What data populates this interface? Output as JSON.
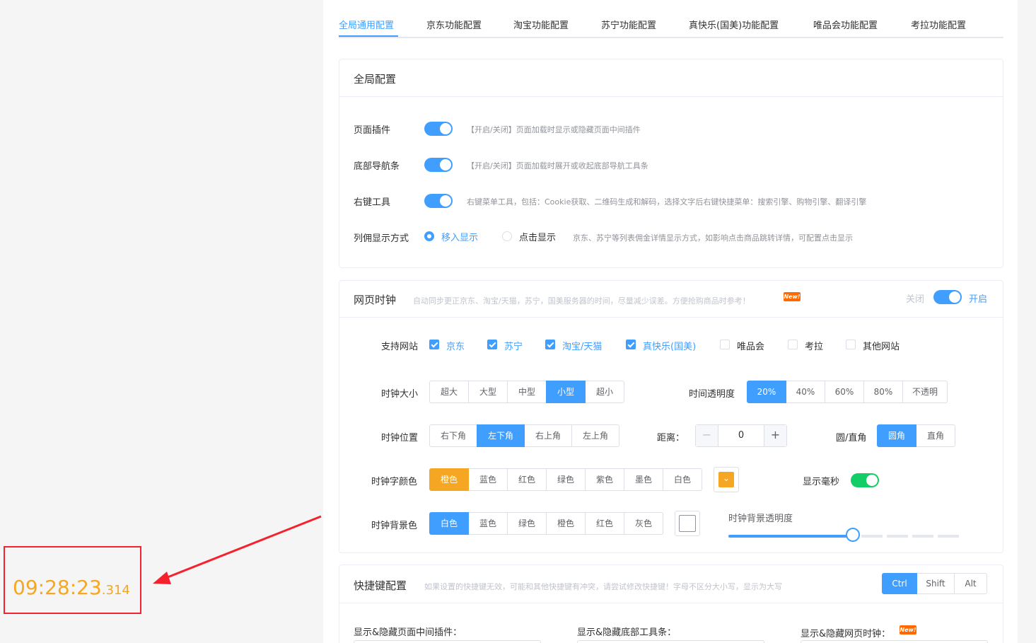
{
  "tabs": [
    "全局通用配置",
    "京东功能配置",
    "淘宝功能配置",
    "苏宁功能配置",
    "真快乐(国美)功能配置",
    "唯品会功能配置",
    "考拉功能配置"
  ],
  "global_config": {
    "title": "全局配置",
    "rows": [
      {
        "label": "页面插件",
        "desc": "【开启/关闭】页面加载时显示或隐藏页面中间插件"
      },
      {
        "label": "底部导航条",
        "desc": "【开启/关闭】页面加载时展开或收起底部导航工具条"
      },
      {
        "label": "右键工具",
        "desc": "右键菜单工具，包括：Cookie获取、二维码生成和解码，选择文字后右键快捷菜单：搜索引擎、购物引擎、翻译引擎"
      }
    ],
    "list_display": {
      "label": "列佣显示方式",
      "options": [
        "移入显示",
        "点击显示"
      ],
      "desc": "京东、苏宁等列表佣金详情显示方式，如影响点击商品跳转详情，可配置点击显示"
    }
  },
  "web_clock": {
    "title": "网页时钟",
    "desc": "自动同步更正京东、淘宝/天猫，苏宁，国美服务器的时间，尽量减少误差。方便抢购商品时参考！",
    "new_badge": "New!",
    "off_label": "关闭",
    "on_label": "开启",
    "sites_label": "支持网站",
    "sites": [
      {
        "name": "京东",
        "checked": true
      },
      {
        "name": "苏宁",
        "checked": true
      },
      {
        "name": "淘宝/天猫",
        "checked": true
      },
      {
        "name": "真快乐(国美)",
        "checked": true
      },
      {
        "name": "唯品会",
        "checked": false
      },
      {
        "name": "考拉",
        "checked": false
      },
      {
        "name": "其他网站",
        "checked": false
      }
    ],
    "size_label": "时钟大小",
    "sizes": [
      "超大",
      "大型",
      "中型",
      "小型",
      "超小"
    ],
    "opacity_label": "时间透明度",
    "opacities": [
      "20%",
      "40%",
      "60%",
      "80%",
      "不透明"
    ],
    "position_label": "时钟位置",
    "positions": [
      "右下角",
      "左下角",
      "右上角",
      "左上角"
    ],
    "distance_label": "距离：",
    "distance_minus": "−",
    "distance_plus": "+",
    "distance_value": "0",
    "corner_label": "圆/直角",
    "corners": [
      "圆角",
      "直角"
    ],
    "font_color_label": "时钟字颜色",
    "font_colors": [
      "橙色",
      "蓝色",
      "红色",
      "绿色",
      "紫色",
      "墨色",
      "白色"
    ],
    "font_color_chevron": "⌄",
    "ms_label": "显示毫秒",
    "bg_color_label": "时钟背景色",
    "bg_colors": [
      "白色",
      "蓝色",
      "绿色",
      "橙色",
      "红色",
      "灰色"
    ],
    "bg_opacity_label": "时钟背景透明度",
    "bg_opacity_value": 0.5,
    "accent_orange": "#f5a623",
    "accent_blue": "#409eff"
  },
  "shortcut": {
    "title": "快捷键配置",
    "desc": "如果设置的快捷键无效，可能和其他快捷键有冲突，请尝试修改快捷键！字母不区分大小写，显示为大写",
    "modifiers": [
      "Ctrl",
      "Shift",
      "Alt"
    ],
    "fields": [
      "显示&隐藏页面中间插件：",
      "显示&隐藏底部工具条：",
      "显示&隐藏网页时钟："
    ]
  },
  "clock_preview": {
    "time": "09:28:23",
    "ms": ".314"
  }
}
